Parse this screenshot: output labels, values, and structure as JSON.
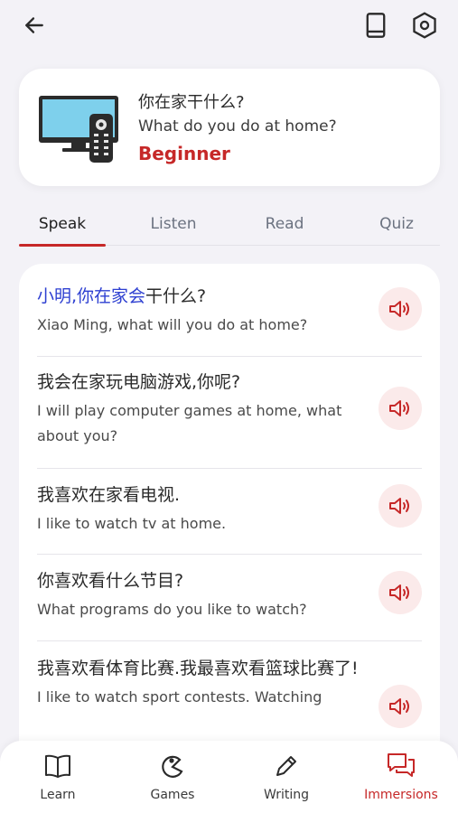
{
  "header": {
    "back_icon": "arrow-left-icon",
    "book_icon": "book-icon",
    "settings_icon": "hexagon-settings-icon"
  },
  "lesson": {
    "title_cn": "你在家干什么?",
    "title_en": "What do you do at home?",
    "level": "Beginner",
    "accent_color": "#c62828"
  },
  "tabs": [
    {
      "label": "Speak",
      "active": true
    },
    {
      "label": "Listen",
      "active": false
    },
    {
      "label": "Read",
      "active": false
    },
    {
      "label": "Quiz",
      "active": false
    }
  ],
  "dialog": [
    {
      "cn_highlight": "小明,你在家会",
      "cn_rest": "干什么?",
      "en": "Xiao Ming, what will you do at home?"
    },
    {
      "cn_highlight": "",
      "cn_rest": "我会在家玩电脑游戏,你呢?",
      "en": "I will play computer games at home, what about you?"
    },
    {
      "cn_highlight": "",
      "cn_rest": "我喜欢在家看电视.",
      "en": "I like to watch tv at home."
    },
    {
      "cn_highlight": "",
      "cn_rest": "你喜欢看什么节目?",
      "en": "What programs do you like to watch?"
    },
    {
      "cn_highlight": "",
      "cn_rest": "我喜欢看体育比赛.我最喜欢看篮球比赛了!",
      "en": "I like to watch sport contests. Watching"
    }
  ],
  "nav": [
    {
      "label": "Learn",
      "icon": "open-book-icon",
      "active": false
    },
    {
      "label": "Games",
      "icon": "games-icon",
      "active": false
    },
    {
      "label": "Writing",
      "icon": "pencil-icon",
      "active": false
    },
    {
      "label": "Immersions",
      "icon": "chat-bubbles-icon",
      "active": true
    }
  ]
}
